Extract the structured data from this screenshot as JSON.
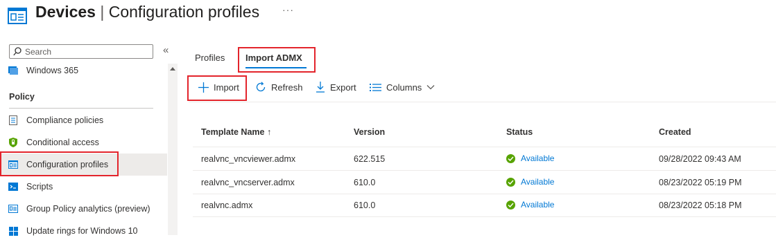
{
  "header": {
    "title_bold": "Devices",
    "title_separator": "|",
    "title_rest": "Configuration profiles",
    "more": "···",
    "icon": "configuration-profile-icon"
  },
  "sidebar": {
    "search_placeholder": "Search",
    "collapse": "«",
    "items_top": [
      {
        "label": "Windows 365",
        "icon": "windows-365-icon"
      }
    ],
    "section_title": "Policy",
    "items": [
      {
        "label": "Compliance policies",
        "icon": "compliance-policies-icon"
      },
      {
        "label": "Conditional access",
        "icon": "conditional-access-icon"
      },
      {
        "label": "Configuration profiles",
        "icon": "configuration-profiles-icon",
        "selected": true
      },
      {
        "label": "Scripts",
        "icon": "scripts-icon"
      },
      {
        "label": "Group Policy analytics (preview)",
        "icon": "group-policy-analytics-icon"
      },
      {
        "label": "Update rings for Windows 10",
        "icon": "windows-logo-icon"
      }
    ]
  },
  "tabs": [
    {
      "label": "Profiles",
      "active": false
    },
    {
      "label": "Import ADMX",
      "active": true
    }
  ],
  "toolbar": {
    "import": "Import",
    "refresh": "Refresh",
    "export": "Export",
    "columns": "Columns"
  },
  "table": {
    "headers": {
      "template_name": "Template Name ↑",
      "version": "Version",
      "status": "Status",
      "created": "Created"
    },
    "rows": [
      {
        "name": "realvnc_vncviewer.admx",
        "version": "622.515",
        "status": "Available",
        "created": "09/28/2022 09:43 AM"
      },
      {
        "name": "realvnc_vncserver.admx",
        "version": "610.0",
        "status": "Available",
        "created": "08/23/2022 05:19 PM"
      },
      {
        "name": "realvnc.admx",
        "version": "610.0",
        "status": "Available",
        "created": "08/23/2022 05:18 PM"
      }
    ]
  },
  "colors": {
    "accent": "#0078d4",
    "highlight_box": "#e3242b",
    "status_ok": "#57a300"
  }
}
